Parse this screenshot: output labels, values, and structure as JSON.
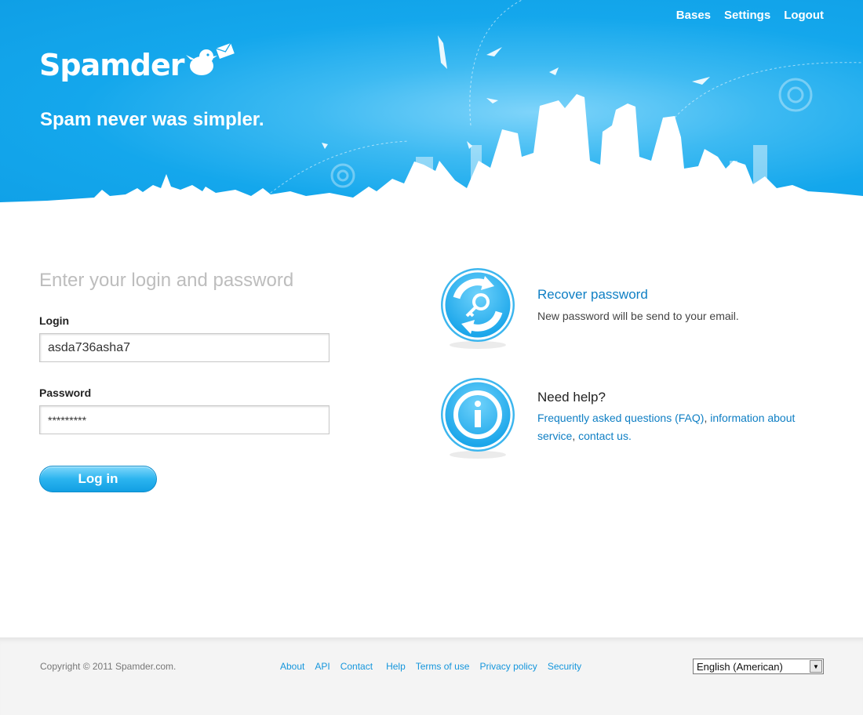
{
  "header": {
    "brand": "Spamder",
    "tagline": "Spam never was simpler.",
    "nav": [
      "Bases",
      "Settings",
      "Logout"
    ]
  },
  "login_form": {
    "title": "Enter your login and password",
    "login_label": "Login",
    "login_value": "asda736asha7",
    "password_label": "Password",
    "password_value": "*********",
    "submit_label": "Log in"
  },
  "recover": {
    "title": "Recover password",
    "text": "New password will be send to your email."
  },
  "help": {
    "title": "Need help?",
    "faq_link": "Frequently asked questions (FAQ)",
    "info_link": "information about service",
    "contact_link": "contact us",
    "separator": ", ",
    "end": "."
  },
  "footer": {
    "copyright": "Copyright © 2011 Spamder.com.",
    "links": [
      "About",
      "API",
      "Contact",
      "Help",
      "Terms of use",
      "Privacy policy",
      "Security"
    ],
    "language": "English (American)"
  },
  "colors": {
    "brand_blue": "#14a7ec",
    "link_blue": "#0f7fc4",
    "footer_link": "#1596dc"
  },
  "icons": [
    "bird-envelope-icon",
    "refresh-key-icon",
    "info-icon",
    "dropdown-arrow-icon"
  ]
}
